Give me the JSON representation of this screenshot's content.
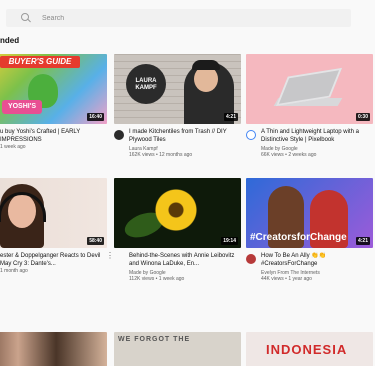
{
  "search": {
    "placeholder": "Search"
  },
  "section": {
    "title": "nded"
  },
  "videos": [
    {
      "title": "u buy Yoshi's Crafted | EARLY IMPRESSIONS",
      "channel": "",
      "stats": "1 week ago",
      "duration": "16:40",
      "avatar_color": "#d6d6d6"
    },
    {
      "title": "I made Kitchentiles from Trash // DIY Plywood Tiles",
      "channel": "Laura Kampf",
      "stats": "162K views • 12 months ago",
      "duration": "4:21",
      "avatar_color": "#2b2b2b"
    },
    {
      "title": "A Thin and Lightweight Laptop with a Distinctive Style | Pixelbook",
      "channel": "Made by Google",
      "stats": "66K views • 2 weeks ago",
      "duration": "0:30",
      "avatar_color": "#4285f4"
    },
    {
      "title": "ester & Doppelganger Reacts to Devil May Cry 3: Dante's...",
      "channel": "",
      "stats": "1 month ago",
      "duration": "58:40",
      "avatar_color": "#d6d6d6"
    },
    {
      "title": "Behind-the-Scenes with Annie Leibovitz and Winona LaDuke, En...",
      "channel": "Made by Google",
      "stats": "112K views • 1 week ago",
      "duration": "19:14",
      "avatar_color": "#4285f4"
    },
    {
      "title": "How To Be An Ally 👏👏 #CreatorsForChange",
      "channel": "Evelyn From The Internets",
      "stats": "44K views • 1 year ago",
      "duration": "4:21",
      "avatar_color": "#b73a3a"
    }
  ],
  "thumb_text": {
    "yoshi_banner": "BUYER'S GUIDE",
    "yoshi_logo": "YOSHI'S",
    "laura_badge": "LAURA KAMPF",
    "creators_tag": "#CreatorsforChange",
    "forgot": "WE FORGOT THE",
    "indo": "INDONESIA"
  }
}
